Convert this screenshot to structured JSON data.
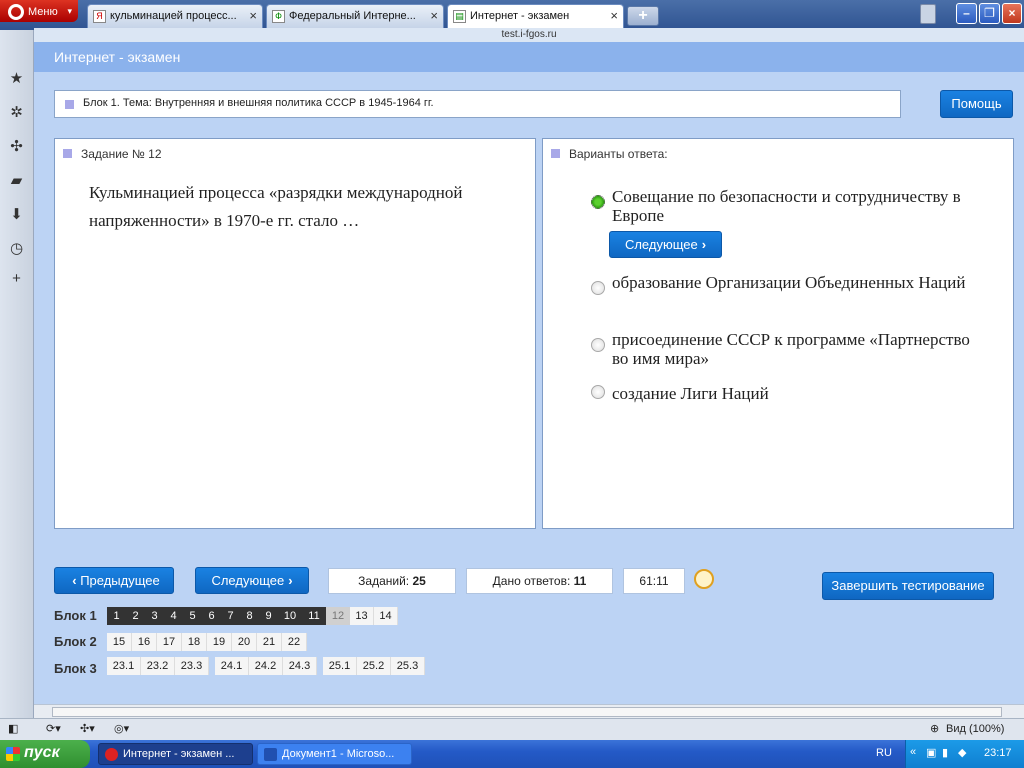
{
  "browser": {
    "menu_label": "Меню",
    "tabs": [
      {
        "title": "кульминацией процесс...",
        "favicon": "Я"
      },
      {
        "title": "Федеральный Интерне...",
        "favicon": "Ф"
      },
      {
        "title": "Интернет - экзамен",
        "favicon": ""
      }
    ],
    "new_tab": "+",
    "address": "test.i-fgos.ru"
  },
  "page": {
    "header_title": "Интернет - экзамен",
    "topic": "Блок 1. Тема: Внутренняя и внешняя политика СССР в 1945-1964 гг.",
    "help_label": "Помощь",
    "task": {
      "title": "Задание № 12",
      "text": "Кульминацией процесса «разрядки международной напряженности» в 1970-е гг. стало …"
    },
    "answers": {
      "title": "Варианты ответа:",
      "options": [
        {
          "text": "Совещание по безопасности и сотрудничеству в Европе",
          "selected": true
        },
        {
          "text": "образование Организации Объединенных Наций",
          "selected": false
        },
        {
          "text": "присоединение СССР к программе «Партнерство во имя мира»",
          "selected": false
        },
        {
          "text": "создание Лиги Наций",
          "selected": false
        }
      ],
      "next_inline_label": "Следующее"
    },
    "nav": {
      "prev_label": "Предыдущее",
      "next_label": "Следующее",
      "tasks_label": "Заданий:",
      "tasks_count": "25",
      "answered_label": "Дано ответов:",
      "answered_count": "11",
      "timer": "61:11",
      "finish_label": "Завершить тестирование"
    },
    "blocks": [
      {
        "label": "Блок 1",
        "items": [
          "1",
          "2",
          "3",
          "4",
          "5",
          "6",
          "7",
          "8",
          "9",
          "10",
          "11",
          "12",
          "13",
          "14"
        ],
        "answered": [
          "1",
          "2",
          "3",
          "4",
          "5",
          "6",
          "7",
          "8",
          "9",
          "10",
          "11"
        ],
        "current": "12"
      },
      {
        "label": "Блок 2",
        "items": [
          "15",
          "16",
          "17",
          "18",
          "19",
          "20",
          "21",
          "22"
        ]
      },
      {
        "label": "Блок 3",
        "groups": [
          [
            "23.1",
            "23.2",
            "23.3"
          ],
          [
            "24.1",
            "24.2",
            "24.3"
          ],
          [
            "25.1",
            "25.2",
            "25.3"
          ]
        ]
      }
    ]
  },
  "statusbar": {
    "zoom_label": "Вид (100%)"
  },
  "taskbar": {
    "start_label": "пуск",
    "windows": [
      {
        "title": "Интернет - экзамен ...",
        "active": true
      },
      {
        "title": "Документ1 - Microso...",
        "active": false
      }
    ],
    "lang": "RU",
    "clock": "23:17"
  },
  "colors": {
    "accent_blue": "#1a82e2",
    "header_blue": "#8bb2ec",
    "page_bg": "#bcd3f4",
    "answered_cell": "#333333",
    "selected_radio": "#2d9a12"
  }
}
